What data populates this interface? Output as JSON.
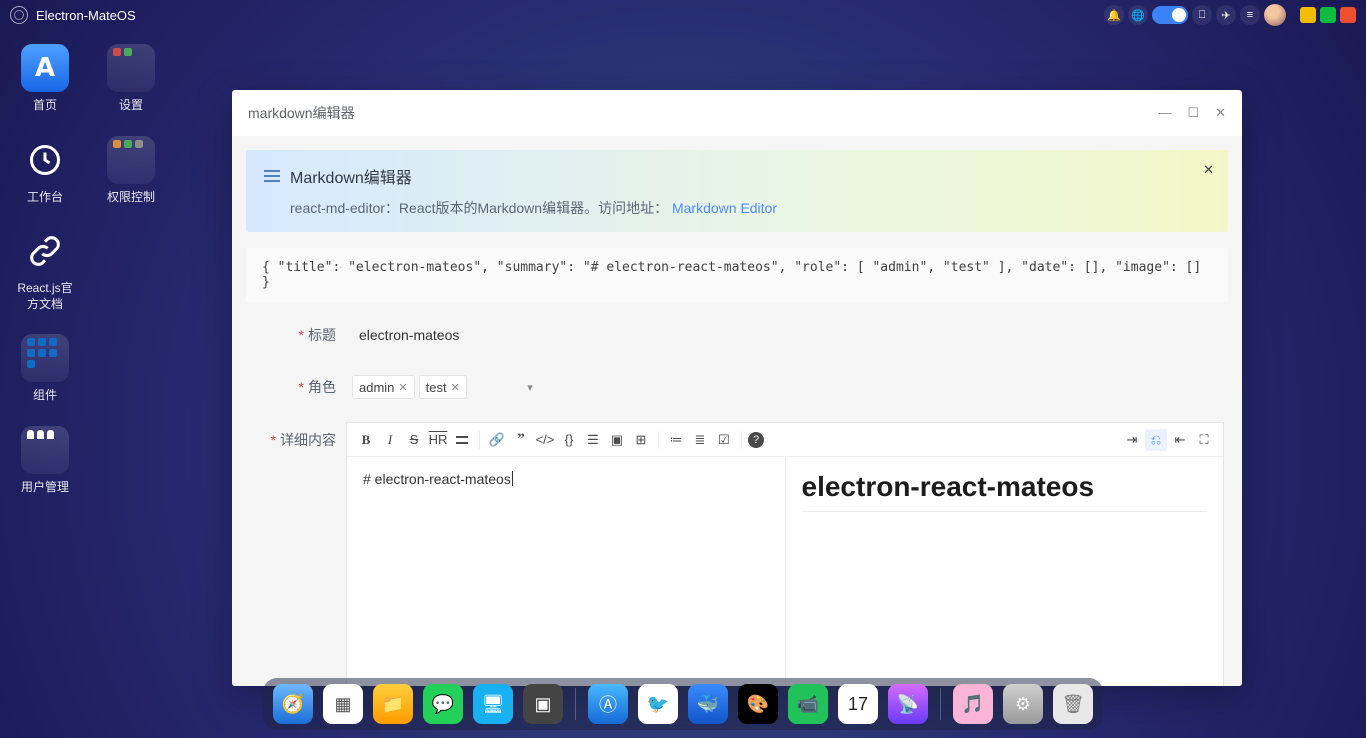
{
  "app": {
    "title": "Electron-MateOS"
  },
  "desktop": {
    "home": "首页",
    "settings": "设置",
    "workbench": "工作台",
    "permission": "权限控制",
    "reactdocs": "React.js官方文档",
    "components": "组件",
    "users": "用户管理"
  },
  "window": {
    "title": "markdown编辑器",
    "alert_title": "Markdown编辑器",
    "alert_desc": "react-md-editor：React版本的Markdown编辑器。访问地址：",
    "alert_link": "Markdown Editor",
    "code_block": "{ \"title\": \"electron-mateos\", \"summary\": \"# electron-react-mateos\", \"role\": [ \"admin\", \"test\" ], \"date\": [], \"image\": [] }",
    "labels": {
      "title": "标题",
      "role": "角色",
      "content": "详细内容"
    },
    "title_value": "electron-mateos",
    "roles": [
      "admin",
      "test"
    ],
    "editor_src": "# electron-react-mateos",
    "preview_h1": "electron-react-mateos"
  },
  "icons": {
    "bell": "bell",
    "globe": "globe",
    "gift": "gift",
    "rocket": "rocket",
    "menu": "menu"
  }
}
